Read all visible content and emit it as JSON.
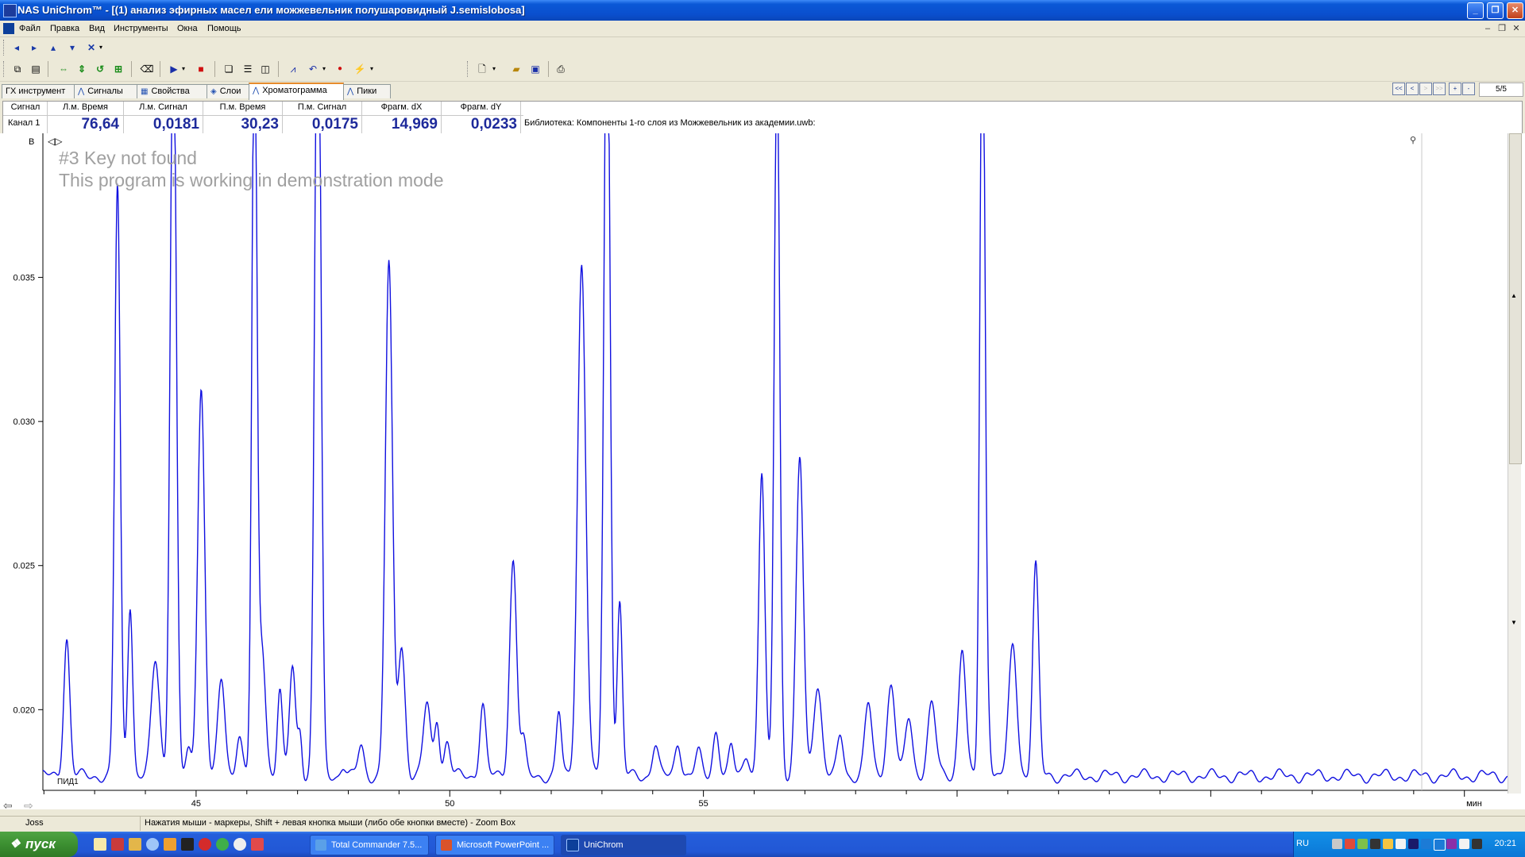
{
  "window": {
    "title": "NAS UniChrom™ - [(1) анализ эфирных масел ели можжевельник полушаровидный J.semislobosa]",
    "colors": {
      "titlebar": "#0a58d6",
      "trace": "#1010e0",
      "tab_accent": "#e68b2c",
      "value_text": "#1e2a9b"
    }
  },
  "menu": {
    "items": [
      "Файл",
      "Правка",
      "Вид",
      "Инструменты",
      "Окна",
      "Помощь"
    ]
  },
  "toolbar1": {
    "icons": [
      "arrow-left-icon",
      "arrow-right-icon",
      "arrow-up-icon",
      "arrow-down-icon",
      "close-x-icon",
      "dropdown-icon"
    ]
  },
  "toolbar2": {
    "icons": [
      "copy-icon",
      "paste-icon",
      "fit-horizontal-icon",
      "fit-vertical-icon",
      "undo-zoom-icon",
      "zoom-fit-icon",
      "clear-icon",
      "play-icon",
      "dropdown-icon",
      "stop-icon",
      "window-cascade-icon",
      "window-tile-h-icon",
      "window-tile-v-icon",
      "markers-icon",
      "undo-icon",
      "dropdown-icon",
      "record-icon",
      "integrate-icon",
      "dropdown-icon",
      "new-document-icon",
      "dropdown-icon",
      "open-folder-icon",
      "save-icon",
      "print-icon"
    ]
  },
  "tabs": [
    {
      "label": "ГХ инструмент",
      "active": false
    },
    {
      "label": "Сигналы",
      "active": false
    },
    {
      "label": "Свойства",
      "active": false
    },
    {
      "label": "Слои",
      "active": false
    },
    {
      "label": "Хроматограмма",
      "active": true
    },
    {
      "label": "Пики",
      "active": false
    }
  ],
  "nav": {
    "buttons": [
      "<<",
      "<",
      ">",
      ">>",
      "+",
      "-"
    ],
    "page": "5/5"
  },
  "info": {
    "headers": [
      "Сигнал",
      "Л.м. Время",
      "Л.м. Сигнал",
      "П.м. Время",
      "П.м. Сигнал",
      "Фрагм. dX",
      "Фрагм. dY"
    ],
    "row_label": "Канал 1",
    "values": [
      "76,64",
      "0,0181",
      "30,23",
      "0,0175",
      "14,969",
      "0,0233"
    ],
    "library": "Библиотека: Компоненты 1-го слоя из Можжевельник из академии.uwb:"
  },
  "watermark": {
    "line1": "#3 Key not found",
    "line2": "This program is working in demonstration mode"
  },
  "chart_data": {
    "type": "line",
    "title": "",
    "xlabel": "мин",
    "ylabel": "",
    "y_axis_marker": "B",
    "series_label": "ПИД1",
    "xlim": [
      41.98,
      70.85
    ],
    "ylim": [
      0.0172,
      0.04
    ],
    "x_ticks": [
      45,
      50,
      55
    ],
    "y_ticks": [
      0.02,
      0.025,
      0.03,
      0.035
    ],
    "y_tick_labels": [
      "0.020",
      "0.025",
      "0.030",
      "0.035"
    ],
    "grid": false,
    "baseline": 0.0177,
    "peaks": [
      [
        42.45,
        0.0048,
        0.06
      ],
      [
        43.45,
        0.0205,
        0.055
      ],
      [
        43.7,
        0.006,
        0.05
      ],
      [
        44.2,
        0.004,
        0.08
      ],
      [
        44.55,
        0.027,
        0.06
      ],
      [
        44.85,
        0.0008,
        0.05
      ],
      [
        45.1,
        0.0135,
        0.07
      ],
      [
        45.5,
        0.0033,
        0.07
      ],
      [
        45.85,
        0.0015,
        0.06
      ],
      [
        46.15,
        0.026,
        0.05
      ],
      [
        46.3,
        0.0045,
        0.07
      ],
      [
        46.65,
        0.003,
        0.05
      ],
      [
        46.9,
        0.0038,
        0.06
      ],
      [
        47.05,
        0.0015,
        0.04
      ],
      [
        47.4,
        0.03,
        0.06
      ],
      [
        47.9,
        0.0004,
        0.05
      ],
      [
        48.25,
        0.001,
        0.06
      ],
      [
        48.8,
        0.0177,
        0.07
      ],
      [
        49.05,
        0.0045,
        0.07
      ],
      [
        49.55,
        0.0025,
        0.07
      ],
      [
        49.75,
        0.002,
        0.05
      ],
      [
        49.95,
        0.0012,
        0.06
      ],
      [
        50.65,
        0.0025,
        0.06
      ],
      [
        51.25,
        0.0075,
        0.07
      ],
      [
        51.45,
        0.0012,
        0.05
      ],
      [
        52.15,
        0.0022,
        0.05
      ],
      [
        52.6,
        0.0178,
        0.08
      ],
      [
        53.1,
        0.0285,
        0.06
      ],
      [
        53.35,
        0.006,
        0.05
      ],
      [
        54.05,
        0.0011,
        0.06
      ],
      [
        54.5,
        0.0012,
        0.06
      ],
      [
        54.9,
        0.0008,
        0.06
      ],
      [
        55.25,
        0.0016,
        0.06
      ],
      [
        55.55,
        0.001,
        0.05
      ],
      [
        55.85,
        0.0008,
        0.06
      ],
      [
        56.15,
        0.0105,
        0.06
      ],
      [
        56.45,
        0.025,
        0.055
      ],
      [
        56.9,
        0.011,
        0.07
      ],
      [
        57.25,
        0.0032,
        0.08
      ],
      [
        57.7,
        0.0014,
        0.06
      ],
      [
        58.25,
        0.0025,
        0.07
      ],
      [
        58.7,
        0.0032,
        0.08
      ],
      [
        59.05,
        0.002,
        0.07
      ],
      [
        59.5,
        0.0025,
        0.08
      ],
      [
        60.1,
        0.0045,
        0.07
      ],
      [
        60.5,
        0.028,
        0.05
      ],
      [
        60.6,
        0.002,
        0.05
      ],
      [
        61.1,
        0.0045,
        0.08
      ],
      [
        61.55,
        0.0073,
        0.06
      ]
    ]
  },
  "statusbar": {
    "user": "Joss",
    "hint": "Нажатия мыши - маркеры, Shift + левая кнопка мыши  (либо обе кнопки вместе) - Zoom Box"
  },
  "taskbar": {
    "start_label": "пуск",
    "tasks": [
      {
        "label": "Total Commander 7.5...",
        "active": false
      },
      {
        "label": "Microsoft PowerPoint ...",
        "active": false
      },
      {
        "label": "UniChrom",
        "active": true
      }
    ],
    "language": "RU",
    "clock": "20:21"
  }
}
